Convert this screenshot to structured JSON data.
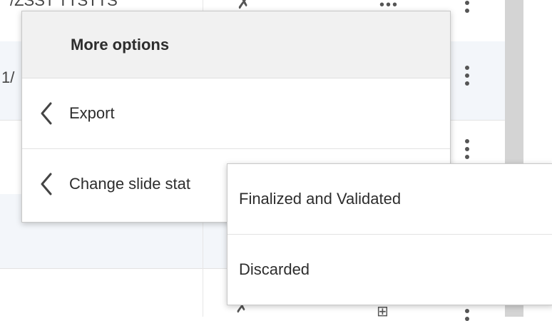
{
  "background": {
    "row_fragments": [
      "1/"
    ],
    "cut_text": "/ZSST TTSTTS"
  },
  "menu": {
    "title": "More options",
    "items": [
      {
        "label": "Export",
        "icon": "chevron-left-icon"
      },
      {
        "label": "Change slide stat",
        "icon": "chevron-left-icon"
      }
    ]
  },
  "submenu": {
    "items": [
      {
        "label": "Finalized and Validated"
      },
      {
        "label": "Discarded"
      }
    ]
  }
}
